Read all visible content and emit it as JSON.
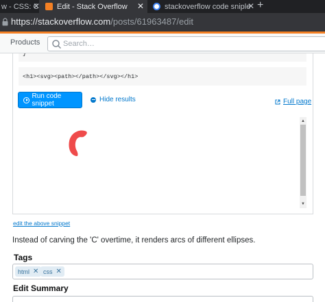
{
  "browser": {
    "tabs": [
      {
        "title": "w - CSS: C",
        "active": false
      },
      {
        "title": "Edit - Stack Overflow",
        "active": true
      },
      {
        "title": "stackoverflow code sniplet not w",
        "active": false
      }
    ],
    "new_tab_symbol": "+",
    "url_host": "https://stackoverflow.com",
    "url_path": "/posts/61963487/edit"
  },
  "topbar": {
    "products_label": "Products",
    "search_placeholder": "Search…"
  },
  "snippet": {
    "code_line_top": "}",
    "code_html": "<h1><svg><path></path></svg></h1>",
    "run_label": "Run code snippet",
    "hide_label": "Hide results",
    "full_page_label": "Full page",
    "edit_link": "edit the above snippet"
  },
  "body_text": "Instead of carving the 'C' overtime, it renders arcs of different ellipses.",
  "tags": {
    "label": "Tags",
    "items": [
      "html",
      "css"
    ]
  },
  "edit_summary": {
    "label": "Edit Summary"
  },
  "colors": {
    "accent": "#0095ff",
    "link": "#0077cc",
    "drawing": "#ef4b4b",
    "so_orange": "#f48024"
  }
}
